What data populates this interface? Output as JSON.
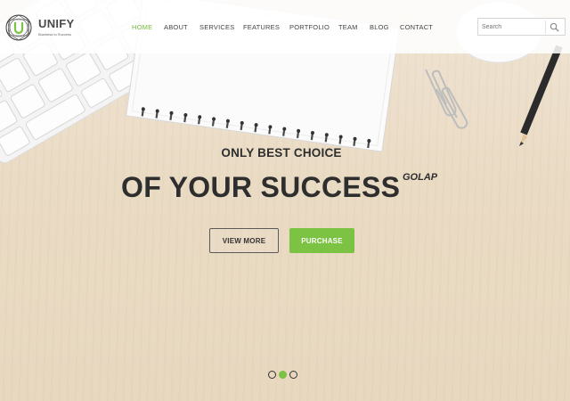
{
  "brand": {
    "name": "UNIFY",
    "tagline": "Business to Success",
    "accent": "#7cc243"
  },
  "nav": {
    "items": [
      {
        "label": "HOME",
        "active": true
      },
      {
        "label": "ABOUT"
      },
      {
        "label": "SERVICES"
      },
      {
        "label": "FEATURES"
      },
      {
        "label": "PORTFOLIO"
      },
      {
        "label": "TEAM"
      },
      {
        "label": "BLOG"
      },
      {
        "label": "CONTACT"
      }
    ]
  },
  "search": {
    "placeholder": "Search",
    "icon": "search-icon"
  },
  "hero": {
    "eyebrow": "ONLY BEST CHOICE",
    "headline": "OF YOUR SUCCESS",
    "marquee": "GOLAP",
    "buttons": {
      "view_more": "VIEW MORE",
      "purchase": "PURCHASE"
    }
  },
  "slider": {
    "slide_count": 3,
    "active_index": 1
  }
}
